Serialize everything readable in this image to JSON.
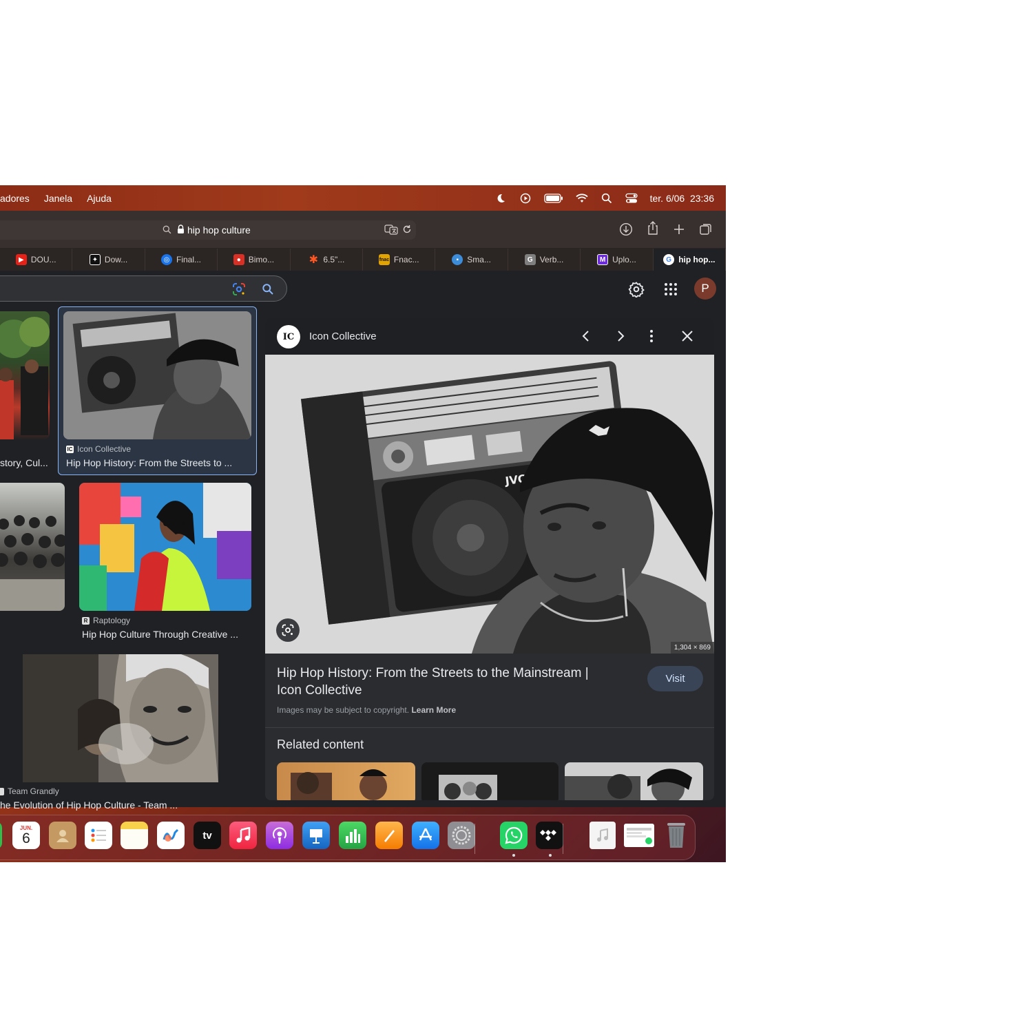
{
  "menubar": {
    "items": [
      "adores",
      "Janela",
      "Ajuda"
    ],
    "clock": "ter. 6/06  23:36"
  },
  "browser": {
    "url": "hip hop culture",
    "tabs": [
      {
        "label": "DOU...",
        "color": "#e62117"
      },
      {
        "label": "Dow...",
        "color": "#111111"
      },
      {
        "label": "Final...",
        "color": "#1a73e8"
      },
      {
        "label": "Bimo...",
        "color": "#d93025"
      },
      {
        "label": "6.5\"...",
        "color": "#ff5722"
      },
      {
        "label": "Fnac...",
        "color": "#e1a400"
      },
      {
        "label": "Sma...",
        "color": "#3c8cd8"
      },
      {
        "label": "Verb...",
        "color": "#7f7f7f"
      },
      {
        "label": "Uplo...",
        "color": "#6c2bd9"
      },
      {
        "label": "hip hop...",
        "color": "#ffffff"
      }
    ]
  },
  "google": {
    "avatar": "P"
  },
  "results": {
    "r1": {
      "source": "",
      "title": "story, Cul..."
    },
    "r2": {
      "source": "Icon Collective",
      "title": "Hip Hop History: From the Streets to ..."
    },
    "r3": {
      "source": "Raptology",
      "title": "Hip Hop Culture Through Creative ..."
    },
    "r4": {
      "source": "Team Grandly",
      "title": "he Evolution of Hip Hop Culture - Team ..."
    }
  },
  "preview": {
    "source": "Icon Collective",
    "dimensions": "1,304 × 869",
    "title": "Hip Hop History: From the Streets to the Mainstream | Icon Collective",
    "visit": "Visit",
    "copyright": "Images may be subject to copyright.",
    "learn_more": "Learn More",
    "related": "Related content"
  },
  "dock": {
    "calendar_month": "JUN.",
    "calendar_day": "6",
    "tv_label": "tv"
  }
}
